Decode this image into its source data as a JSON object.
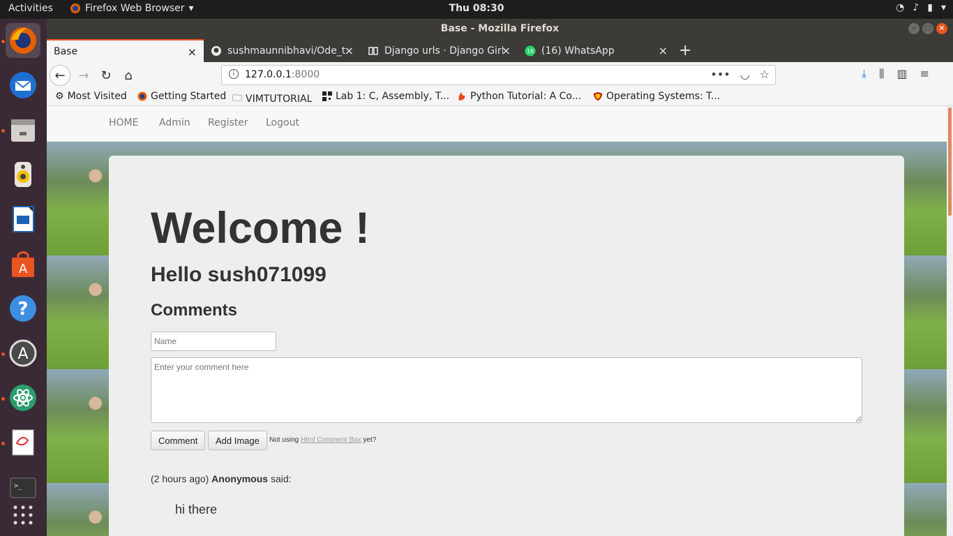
{
  "topbar": {
    "activities": "Activities",
    "app_name": "Firefox Web Browser",
    "clock": "Thu 08:30"
  },
  "window": {
    "title": "Base - Mozilla Firefox"
  },
  "tabs": [
    {
      "label": "Base",
      "active": true
    },
    {
      "label": "sushmaunnibhavi/Ode_t",
      "active": false
    },
    {
      "label": "Django urls · Django Girls",
      "active": false
    },
    {
      "label": "(16) WhatsApp",
      "active": false
    }
  ],
  "navbar": {
    "url_host": "127.0.0.1",
    "url_port": ":8000"
  },
  "bookmarks": [
    {
      "label": "Most Visited",
      "icon": "gear-icon"
    },
    {
      "label": "Getting Started",
      "icon": "firefox-icon"
    },
    {
      "label": "VIMTUTORIAL",
      "icon": "folder-icon"
    },
    {
      "label": "Lab 1: C, Assembly, T...",
      "icon": "qr-icon"
    },
    {
      "label": "Python Tutorial: A Co...",
      "icon": "flame-icon"
    },
    {
      "label": "Operating Systems: T...",
      "icon": "shield-icon"
    }
  ],
  "site_nav": {
    "home": "HOME",
    "admin": "Admin",
    "register": "Register",
    "logout": "Logout"
  },
  "main": {
    "welcome": "Welcome !",
    "hello": "Hello sush071099",
    "comments_heading": "Comments",
    "name_placeholder": "Name",
    "comment_placeholder": "Enter your comment here",
    "comment_button": "Comment",
    "add_image_button": "Add Image",
    "not_using_prefix": "Not using",
    "not_using_link": "Html Comment Box",
    "not_using_suffix": "yet?",
    "comment_time": "(2 hours ago)",
    "comment_author": "Anonymous",
    "comment_said": "said:",
    "comment_text": "hi there"
  },
  "colors": {
    "accent": "#e95420",
    "dock_bg": "#3a2a35"
  }
}
